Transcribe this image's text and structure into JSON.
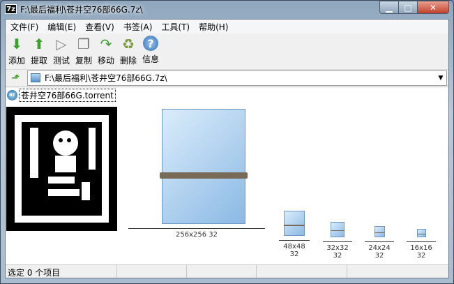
{
  "window": {
    "title": "F:\\最后福利\\苍井空76部66G.7z\\",
    "app_icon": "7z"
  },
  "menu": [
    "文件(F)",
    "编辑(E)",
    "查看(V)",
    "书签(A)",
    "工具(T)",
    "帮助(H)"
  ],
  "toolbar": [
    {
      "label": "添加",
      "icon": "add-icon",
      "glyph": "⬇",
      "color": "#3aa12a"
    },
    {
      "label": "提取",
      "icon": "extract-icon",
      "glyph": "⬆",
      "color": "#3aa12a"
    },
    {
      "label": "测试",
      "icon": "test-icon",
      "glyph": "▷",
      "color": "#888888"
    },
    {
      "label": "复制",
      "icon": "copy-icon",
      "glyph": "❐",
      "color": "#777777"
    },
    {
      "label": "移动",
      "icon": "move-icon",
      "glyph": "↷",
      "color": "#3aa12a"
    },
    {
      "label": "删除",
      "icon": "delete-icon",
      "glyph": "♻",
      "color": "#7a9a3a"
    },
    {
      "label": "信息",
      "icon": "info-icon",
      "glyph": "?",
      "color": "#2f6db5"
    }
  ],
  "address": {
    "path": "F:\\最后福利\\苍井空76部66G.7z\\"
  },
  "file": {
    "name": "苍井空76部66G.torrent",
    "badge": "BT"
  },
  "icon_sizes": [
    "256x256 32",
    "48x48 32",
    "32x32 32",
    "24x24 32",
    "16x16 32"
  ],
  "status": {
    "text": "选定 0 个项目"
  }
}
